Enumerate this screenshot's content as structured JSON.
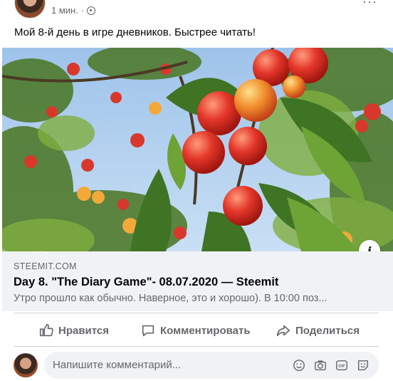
{
  "post": {
    "time": "1 мин.",
    "dot": "·",
    "text": "Мой 8-й день в игре дневников. Быстрее читать!",
    "more": "···"
  },
  "link": {
    "domain": "STEEMIT.COM",
    "title": "Day 8. \"The Diary Game\"- 08.07.2020 — Steemit",
    "description": "Утро прошло как обычно. Наверное, это и хорошо). В 10:00 поз...",
    "info": "i"
  },
  "actions": {
    "like": "Нравится",
    "comment": "Комментировать",
    "share": "Поделиться"
  },
  "comment": {
    "placeholder": "Напишите комментарий..."
  },
  "icons": [
    "globe-icon",
    "info-icon",
    "like-icon",
    "comment-icon",
    "share-icon",
    "emoji-icon",
    "camera-icon",
    "gif-icon",
    "sticker-icon"
  ]
}
